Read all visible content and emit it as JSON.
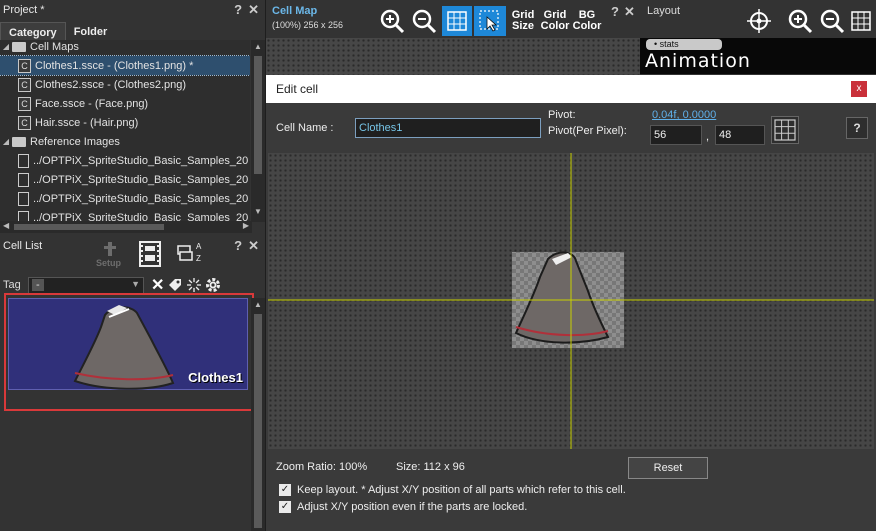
{
  "project": {
    "title": "Project *",
    "controls": [
      "?",
      "✕"
    ],
    "tabs": [
      "Category",
      "Folder"
    ],
    "tree": [
      {
        "label": "Cell Maps",
        "type": "folder",
        "indent": 0
      },
      {
        "label": "Clothes1.ssce - (Clothes1.png) *",
        "type": "cell",
        "indent": 1,
        "selected": true
      },
      {
        "label": "Clothes2.ssce - (Clothes2.png)",
        "type": "cell",
        "indent": 1
      },
      {
        "label": "Face.ssce - (Face.png)",
        "type": "cell",
        "indent": 1
      },
      {
        "label": "Hair.ssce - (Hair.png)",
        "type": "cell",
        "indent": 1
      },
      {
        "label": "Reference Images",
        "type": "folder",
        "indent": 0
      },
      {
        "label": "../OPTPiX_SpriteStudio_Basic_Samples_20",
        "type": "doc",
        "indent": 1
      },
      {
        "label": "../OPTPiX_SpriteStudio_Basic_Samples_20",
        "type": "doc",
        "indent": 1
      },
      {
        "label": "../OPTPiX_SpriteStudio_Basic_Samples_20",
        "type": "doc",
        "indent": 1
      },
      {
        "label": "../OPTPiX_SpriteStudio_Basic_Samples_20",
        "type": "doc",
        "indent": 1
      }
    ]
  },
  "cell_list": {
    "title": "Cell List",
    "setup_label": "Setup",
    "sort_label_a": "A",
    "sort_label_z": "Z",
    "tag_label": "Tag",
    "tag_value": "-",
    "cell_name": "Clothes1"
  },
  "cell_map": {
    "title": "Cell Map",
    "subtitle": "(100%) 256 x 256",
    "grid_size": [
      "Grid",
      "Size"
    ],
    "grid_color": [
      "Grid",
      "Color"
    ],
    "bg_color": [
      "BG",
      "Color"
    ]
  },
  "layout": {
    "title": "Layout",
    "stats": "• stats",
    "animation": "Animation"
  },
  "edit_cell": {
    "title": "Edit cell",
    "close": "x",
    "cell_name_label": "Cell Name :",
    "cell_name_value": "Clothes1",
    "pivot_label": "Pivot:",
    "pivot_value": "0.04f, 0.0000",
    "pivot_px_label": "Pivot(Per Pixel):",
    "pivot_x": "56",
    "pivot_sep": ",",
    "pivot_y": "48",
    "help": "?",
    "zoom_ratio": "Zoom Ratio: 100%",
    "size": "Size: 112 x 96",
    "reset": "Reset",
    "keep_layout": "Keep layout. * Adjust X/Y position of all parts which refer to this cell.",
    "adjust_locked": "Adjust X/Y position even if the parts are locked.",
    "check": "✓"
  },
  "colors": {
    "accent": "#1e88d8",
    "title_blue": "#6bb7e8",
    "highlight": "#d9393a",
    "cell_bg": "#30307a",
    "crosshair": "#c8d000"
  }
}
